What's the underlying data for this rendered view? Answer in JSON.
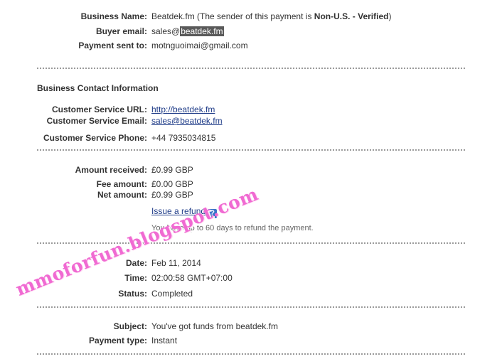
{
  "buyer": {
    "business_name_label": "Business Name:",
    "business_name_value": "Beatdek.fm (The sender of this payment is ",
    "business_name_status": "Non-U.S. - Verified",
    "business_name_close": ")",
    "buyer_email_label": "Buyer email:",
    "buyer_email_prefix": "sales@",
    "buyer_email_domain": "beatdek.fm",
    "payment_sent_to_label": "Payment sent to:",
    "payment_sent_to_value": "motnguoimai@gmail.com"
  },
  "contact": {
    "section_title": "Business Contact Information",
    "service_url_label": "Customer Service URL:",
    "service_url_value": "http://beatdek.fm",
    "service_email_label": "Customer Service Email:",
    "service_email_value": "sales@beatdek.fm",
    "service_phone_label": "Customer Service Phone:",
    "service_phone_value": "+44 7935034815"
  },
  "amounts": {
    "received_label": "Amount received:",
    "received_value": "£0.99 GBP",
    "fee_label": "Fee amount:",
    "fee_value": "£0.00 GBP",
    "net_label": "Net amount:",
    "net_value": "£0.99 GBP",
    "refund_link": "Issue a refund",
    "help_icon_glyph": "?",
    "refund_note": "You have up to 60 days to refund the payment."
  },
  "details": {
    "date_label": "Date:",
    "date_value": "Feb 11, 2014",
    "time_label": "Time:",
    "time_value": "02:00:58 GMT+07:00",
    "status_label": "Status:",
    "status_value": "Completed"
  },
  "payment": {
    "subject_label": "Subject:",
    "subject_value": "You've got funds from beatdek.fm",
    "type_label": "Payment type:",
    "type_value": "Instant"
  },
  "watermark": {
    "text": "mmoforfun.blogspot.com",
    "color": "#f06ad2"
  },
  "colors": {
    "link": "#1f3c88",
    "help_icon": "#3a73c8",
    "selection_highlight": "#5a5a5a"
  }
}
